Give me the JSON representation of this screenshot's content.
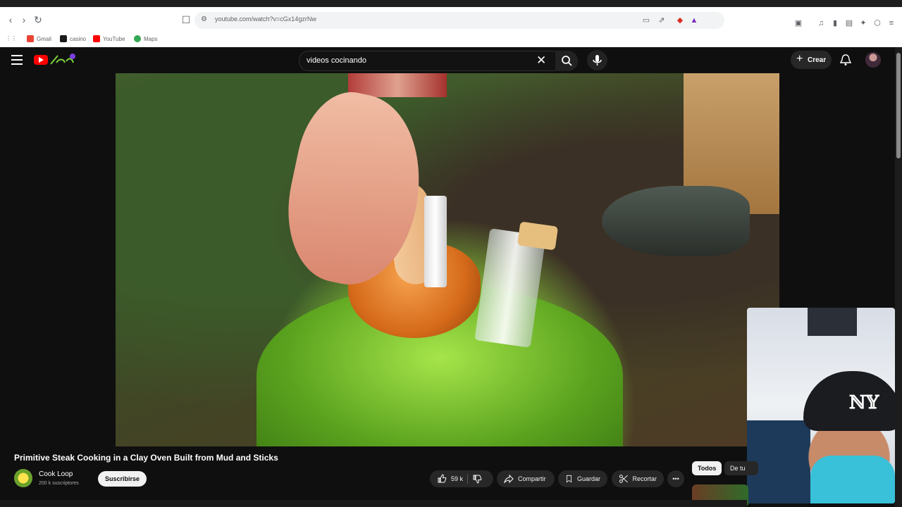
{
  "browser": {
    "url": "youtube.com/watch?v=cGx14gzrNw",
    "bookmarks": [
      {
        "label": "Gmail",
        "color": "#ea4335"
      },
      {
        "label": "casino",
        "color": "#1b1b1b"
      },
      {
        "label": "YouTube",
        "color": "#ff0000"
      },
      {
        "label": "Maps",
        "color": "#34a853"
      }
    ]
  },
  "youtube": {
    "search_query": "videos cocinando",
    "create_label": "Crear"
  },
  "video": {
    "title": "Primitive Steak Cooking in a Clay Oven Built from Mud and Sticks",
    "channel": "Cook Loop",
    "subscribers": "200 k suscriptores",
    "subscribe_label": "Suscribirse",
    "likes": "59 k",
    "share_label": "Compartir",
    "save_label": "Guardar",
    "clip_label": "Recortar"
  },
  "chips": {
    "all": "Todos",
    "from": "De tu"
  },
  "colors": {
    "brand_red": "#ff0000",
    "background": "#0f0f0f"
  }
}
